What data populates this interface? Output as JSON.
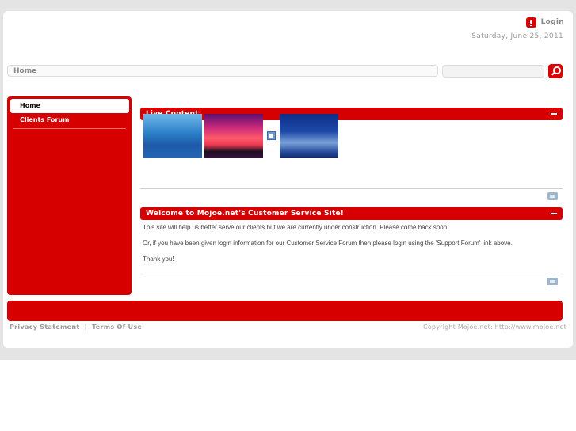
{
  "header": {
    "login_label": "Login",
    "date": "Saturday, June 25, 2011"
  },
  "nav": {
    "home_label": "Home"
  },
  "search": {
    "placeholder": ""
  },
  "sidebar": {
    "items": [
      {
        "label": "Home"
      },
      {
        "label": "Clients Forum"
      }
    ]
  },
  "panels": {
    "live": {
      "title": "Live Content"
    },
    "welcome": {
      "title": "Welcome to Mojoe.net's Customer Service Site!",
      "paragraphs": [
        "This site will help us better serve our clients but we are currently under construction. Please come back soon.",
        "Or, if you have been given login information for our Customer Service Forum then please login using the 'Support Forum' link above.",
        "Thank you!"
      ]
    }
  },
  "footer": {
    "privacy": "Privacy Statement",
    "separator": "|",
    "terms": "Terms Of Use",
    "copyright": "Copyright Mojoe.net: http://www.mojoe.net"
  },
  "colors": {
    "accent": "#d60000",
    "background": "#e4e4e4"
  },
  "icons": [
    "login-icon",
    "search-icon",
    "collapse-icon",
    "image-icon",
    "edit-icon"
  ]
}
